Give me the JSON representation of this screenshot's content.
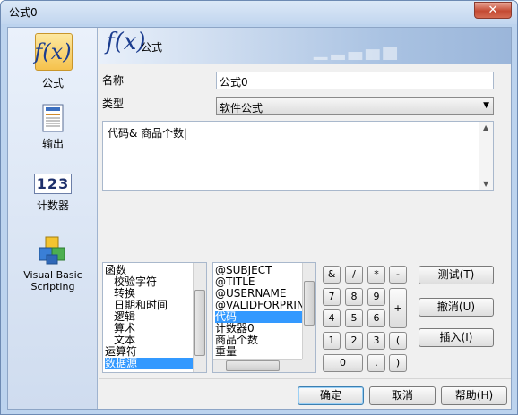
{
  "window": {
    "title": "公式0",
    "close_label": "✕"
  },
  "nav": {
    "items": [
      {
        "label": "公式",
        "icon": "formula-icon",
        "selected": true
      },
      {
        "label": "输出",
        "icon": "document-icon"
      },
      {
        "label": "计数器",
        "icon": "counter-icon",
        "glyph": "123"
      },
      {
        "label": "Visual Basic Scripting",
        "icon": "vbs-blocks-icon"
      }
    ],
    "fx_glyph": "f(x)"
  },
  "banner": {
    "title": "公式",
    "fx_glyph": "f(x)"
  },
  "form": {
    "name_label": "名称",
    "name_value": "公式0",
    "type_label": "类型",
    "type_value": "软件公式",
    "expression": "代码& 商品个数|"
  },
  "categories": {
    "items": [
      "函数",
      "校验字符",
      "转换",
      "日期和时间",
      "逻辑",
      "算术",
      "文本",
      "运算符",
      "数据源"
    ],
    "selected": "数据源"
  },
  "fields": {
    "items": [
      "@SUBJECT",
      "@TITLE",
      "@USERNAME",
      "@VALIDFORPRINT",
      "代码",
      "计数器0",
      "商品个数",
      "重量"
    ],
    "selected": "代码"
  },
  "keypad": {
    "row1": [
      "&",
      "/",
      "*",
      "-"
    ],
    "row2": [
      "7",
      "8",
      "9"
    ],
    "row3": [
      "4",
      "5",
      "6"
    ],
    "row4": [
      "1",
      "2",
      "3"
    ],
    "zero": "0",
    "dot": ".",
    "plus": "+",
    "lparen": "(",
    "rparen": ")"
  },
  "actions": {
    "test": "测试(T)",
    "undo": "撤消(U)",
    "insert": "插入(I)"
  },
  "footer": {
    "ok": "确定",
    "cancel": "取消",
    "help": "帮助(H)"
  },
  "colors": {
    "selection": "#3399ff",
    "nav_bg": "#cfdcef",
    "title_bar": "#c2d6ef",
    "close_red": "#c44a33"
  }
}
